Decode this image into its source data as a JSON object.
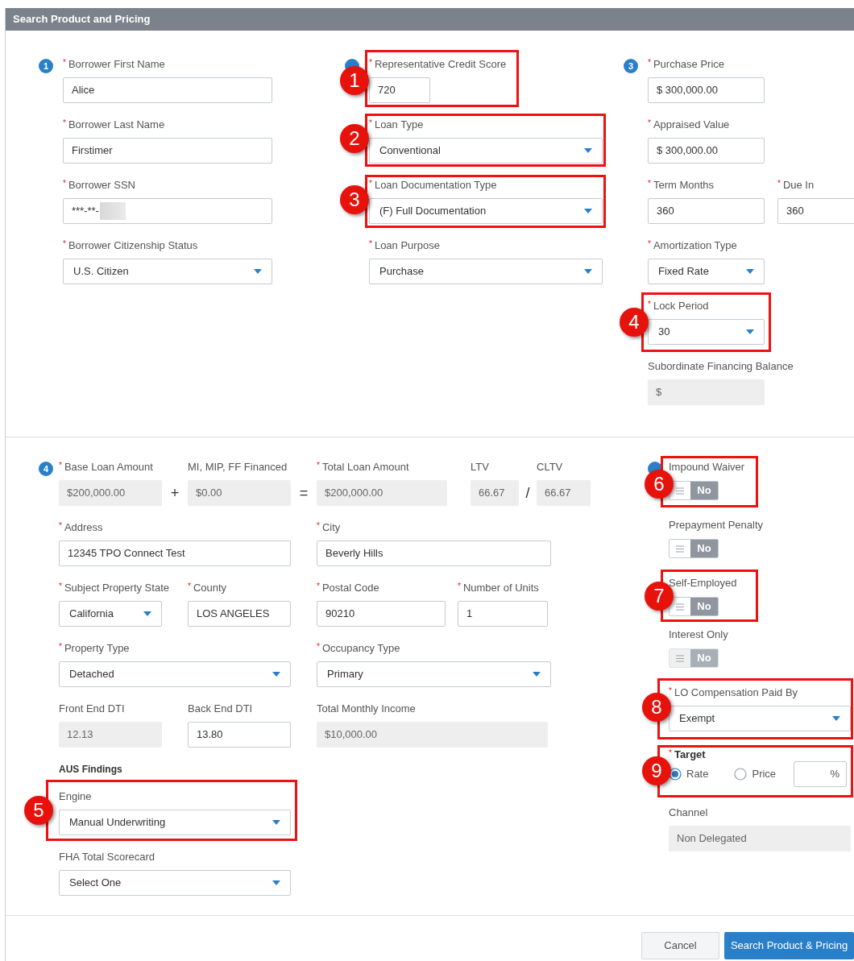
{
  "window": {
    "title": "Search Product and Pricing"
  },
  "required_mark": "*",
  "borrower": {
    "step": "1",
    "fields": [
      {
        "label": "Borrower First Name",
        "required": true,
        "kind": "text",
        "value": "Alice"
      },
      {
        "label": "Borrower Last Name",
        "required": true,
        "kind": "text",
        "value": "Firstimer"
      },
      {
        "label": "Borrower SSN",
        "required": true,
        "kind": "masked",
        "value": "***-**-"
      },
      {
        "label": "Borrower Citizenship Status",
        "required": true,
        "kind": "select",
        "value": "U.S. Citizen"
      }
    ]
  },
  "loan": {
    "fields": [
      {
        "label": "Representative Credit Score",
        "required": true,
        "kind": "text",
        "value": "720"
      },
      {
        "label": "Loan Type",
        "required": true,
        "kind": "select",
        "value": "Conventional"
      },
      {
        "label": "Loan Documentation Type",
        "required": true,
        "kind": "select",
        "value": "(F) Full Documentation"
      },
      {
        "label": "Loan Purpose",
        "required": true,
        "kind": "select",
        "value": "Purchase"
      }
    ]
  },
  "property_value": {
    "step": "3",
    "fields": [
      {
        "label": "Purchase Price",
        "required": true,
        "kind": "text",
        "value": "$ 300,000.00"
      },
      {
        "label": "Appraised Value",
        "required": true,
        "kind": "text",
        "value": "$ 300,000.00"
      },
      {
        "label": "Term Months",
        "required": true,
        "kind": "text",
        "value": "360"
      },
      {
        "label": "Due In",
        "required": true,
        "kind": "text",
        "value": "360"
      },
      {
        "label": "Amortization Type",
        "required": true,
        "kind": "select",
        "value": "Fixed Rate"
      },
      {
        "label": "Lock Period",
        "required": true,
        "kind": "select",
        "value": "30"
      },
      {
        "label": "Subordinate Financing Balance",
        "required": false,
        "kind": "readonly",
        "value": "$"
      }
    ]
  },
  "loan_details": {
    "step": "4",
    "amounts": [
      {
        "label": "Base Loan Amount",
        "required": true,
        "kind": "readonly",
        "value": "$200,000.00"
      },
      {
        "label": "MI, MIP, FF Financed",
        "required": false,
        "kind": "readonly",
        "value": "$0.00"
      },
      {
        "label": "Total Loan Amount",
        "required": true,
        "kind": "readonly",
        "value": "$200,000.00"
      },
      {
        "label": "LTV",
        "required": false,
        "kind": "readonly",
        "value": "66.67"
      },
      {
        "label": "CLTV",
        "required": false,
        "kind": "readonly",
        "value": "66.67"
      }
    ],
    "operators": [
      "+",
      "=",
      "/"
    ],
    "fields": [
      {
        "label": "Address",
        "required": true,
        "kind": "text",
        "value": "12345 TPO Connect Test"
      },
      {
        "label": "City",
        "required": true,
        "kind": "text",
        "value": "Beverly Hills"
      },
      {
        "label": "Subject Property State",
        "required": true,
        "kind": "select",
        "value": "California"
      },
      {
        "label": "County",
        "required": true,
        "kind": "text",
        "value": "LOS ANGELES"
      },
      {
        "label": "Postal Code",
        "required": true,
        "kind": "text",
        "value": "90210"
      },
      {
        "label": "Number of Units",
        "required": true,
        "kind": "text",
        "value": "1"
      },
      {
        "label": "Property Type",
        "required": true,
        "kind": "select",
        "value": "Detached"
      },
      {
        "label": "Occupancy Type",
        "required": true,
        "kind": "select",
        "value": "Primary"
      },
      {
        "label": "Front End DTI",
        "required": false,
        "kind": "readonly",
        "value": "12.13"
      },
      {
        "label": "Back End DTI",
        "required": false,
        "kind": "text",
        "value": "13.80"
      },
      {
        "label": "Total Monthly Income",
        "required": false,
        "kind": "readonly",
        "value": "$10,000.00"
      }
    ],
    "aus": {
      "heading": "AUS Findings",
      "fields": [
        {
          "label": "Engine",
          "required": false,
          "kind": "select",
          "value": "Manual Underwriting"
        },
        {
          "label": "FHA Total Scorecard",
          "required": false,
          "kind": "select",
          "value": "Select One"
        }
      ]
    }
  },
  "options": {
    "toggles": [
      {
        "label": "Impound Waiver",
        "on": false,
        "disabled": false,
        "value": "No"
      },
      {
        "label": "Prepayment Penalty",
        "on": false,
        "disabled": false,
        "value": "No"
      },
      {
        "label": "Self-Employed",
        "on": false,
        "disabled": false,
        "value": "No"
      },
      {
        "label": "Interest Only",
        "on": false,
        "disabled": true,
        "value": "No"
      }
    ],
    "lo_compensation": {
      "label": "LO Compensation Paid By",
      "required": true,
      "kind": "select",
      "value": "Exempt"
    },
    "target": {
      "label": "Target",
      "required": true,
      "options": [
        {
          "label": "Rate",
          "selected": true
        },
        {
          "label": "Price",
          "selected": false
        }
      ],
      "suffix": "%"
    },
    "channel": {
      "label": "Channel",
      "required": false,
      "kind": "readonly",
      "value": "Non Delegated"
    }
  },
  "buttons": [
    {
      "label": "Cancel",
      "kind": "secondary"
    },
    {
      "label": "Search Product & Pricing",
      "kind": "primary"
    }
  ],
  "callouts": [
    "1",
    "2",
    "3",
    "4",
    "5",
    "6",
    "7",
    "8",
    "9"
  ]
}
